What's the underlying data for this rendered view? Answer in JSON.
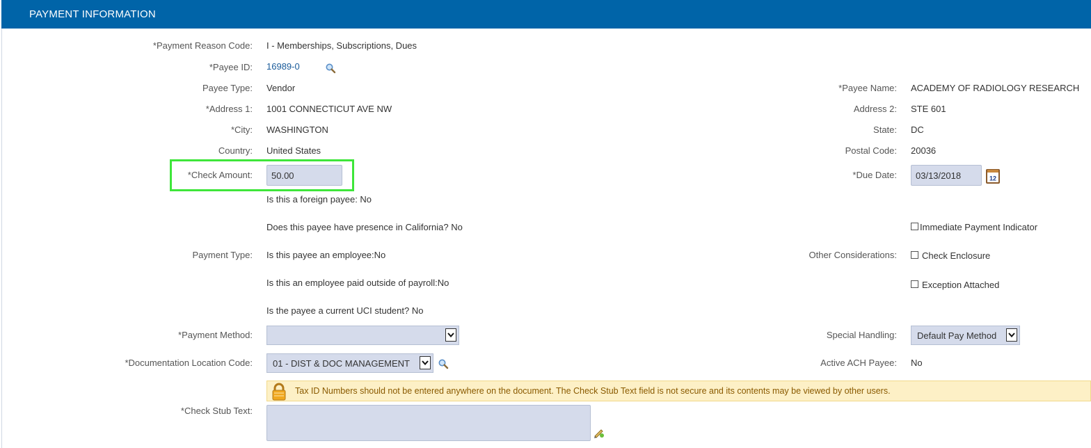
{
  "header": {
    "title": "PAYMENT INFORMATION"
  },
  "fields": {
    "payment_reason_code": {
      "label": "*Payment Reason Code:",
      "value": "I - Memberships, Subscriptions, Dues"
    },
    "payee_id": {
      "label": "*Payee ID:",
      "value": "16989-0"
    },
    "payee_type": {
      "label": "Payee Type:",
      "value": "Vendor"
    },
    "payee_name": {
      "label": "*Payee Name:",
      "value": "ACADEMY OF RADIOLOGY RESEARCH"
    },
    "address1": {
      "label": "*Address 1:",
      "value": "1001 CONNECTICUT AVE NW"
    },
    "address2": {
      "label": "Address 2:",
      "value": "STE 601"
    },
    "city": {
      "label": "*City:",
      "value": "WASHINGTON"
    },
    "state": {
      "label": "State:",
      "value": "DC"
    },
    "country": {
      "label": "Country:",
      "value": "United States"
    },
    "postal_code": {
      "label": "Postal Code:",
      "value": "20036"
    },
    "check_amount": {
      "label": "*Check Amount:",
      "value": "50.00"
    },
    "due_date": {
      "label": "*Due Date:",
      "value": "03/13/2018"
    }
  },
  "payment_type": {
    "label": "Payment Type:",
    "questions": [
      "Is this a foreign payee: No",
      "Does this payee have presence in California?  No",
      "Is this payee an employee:No",
      "Is this an employee paid outside of payroll:No",
      "Is the payee a current UCI student?  No"
    ]
  },
  "other_considerations": {
    "label": "Other Considerations:",
    "immediate_payment": "Immediate Payment Indicator",
    "check_enclosure": "Check Enclosure",
    "exception_attached": "Exception Attached"
  },
  "payment_method": {
    "label": "*Payment Method:",
    "value": ""
  },
  "special_handling": {
    "label": "Special Handling:",
    "value": "Default Pay Method"
  },
  "documentation_location": {
    "label": "*Documentation Location Code:",
    "value": "01 - DIST & DOC MANAGEMENT"
  },
  "active_ach_payee": {
    "label": "Active ACH Payee:",
    "value": "No"
  },
  "notice": {
    "text": "Tax ID Numbers should not be entered anywhere on the document. The Check Stub Text field is not secure and its contents may be viewed by other users."
  },
  "check_stub_text": {
    "label": "*Check Stub Text:",
    "value": ""
  },
  "colors": {
    "header": "#0064a8",
    "input_bg": "#d5dbeb",
    "highlight": "#3ee63a",
    "notice_bg": "#fdf0c6"
  }
}
